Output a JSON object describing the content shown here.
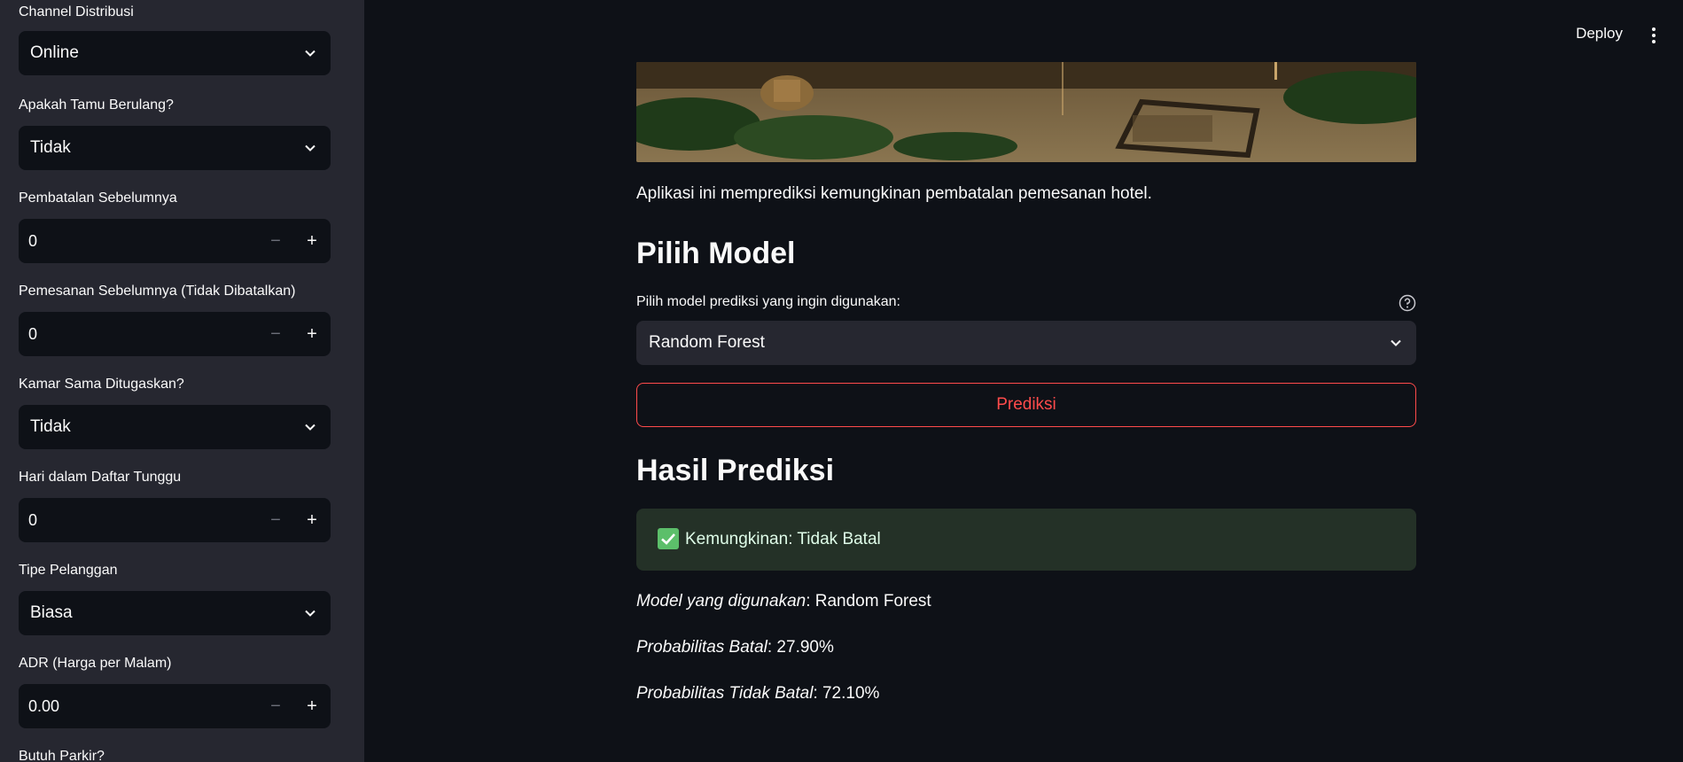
{
  "sidebar": {
    "fields": [
      {
        "label": "Channel Distribusi",
        "type": "select",
        "value": "Online"
      },
      {
        "label": "Apakah Tamu Berulang?",
        "type": "select",
        "value": "Tidak"
      },
      {
        "label": "Pembatalan Sebelumnya",
        "type": "number",
        "value": "0"
      },
      {
        "label": "Pemesanan Sebelumnya (Tidak Dibatalkan)",
        "type": "number",
        "value": "0"
      },
      {
        "label": "Kamar Sama Ditugaskan?",
        "type": "select",
        "value": "Tidak"
      },
      {
        "label": "Hari dalam Daftar Tunggu",
        "type": "number",
        "value": "0"
      },
      {
        "label": "Tipe Pelanggan",
        "type": "select",
        "value": "Biasa"
      },
      {
        "label": "ADR (Harga per Malam)",
        "type": "number",
        "value": "0.00"
      },
      {
        "label": "Butuh Parkir?",
        "type": "select",
        "value": ""
      }
    ],
    "stepper_minus": "−",
    "stepper_plus": "+"
  },
  "header": {
    "deploy_label": "Deploy"
  },
  "main": {
    "description": "Aplikasi ini memprediksi kemungkinan pembatalan pemesanan hotel.",
    "model_section_title": "Pilih Model",
    "model_select_label": "Pilih model prediksi yang ingin digunakan:",
    "model_select_value": "Random Forest",
    "predict_button_label": "Prediksi",
    "result_section_title": "Hasil Prediksi",
    "result_success_text": "Kemungkinan: Tidak Batal",
    "model_used_label": "Model yang digunakan",
    "model_used_value": ": Random Forest",
    "prob_cancel_label": "Probabilitas Batal",
    "prob_cancel_value": ": 27.90%",
    "prob_not_cancel_label": "Probabilitas Tidak Batal",
    "prob_not_cancel_value": ": 72.10%"
  },
  "colors": {
    "accent": "#ff4b4b",
    "success_bg": "#243127",
    "sidebar_bg": "#262730",
    "main_bg": "#0e1117"
  }
}
